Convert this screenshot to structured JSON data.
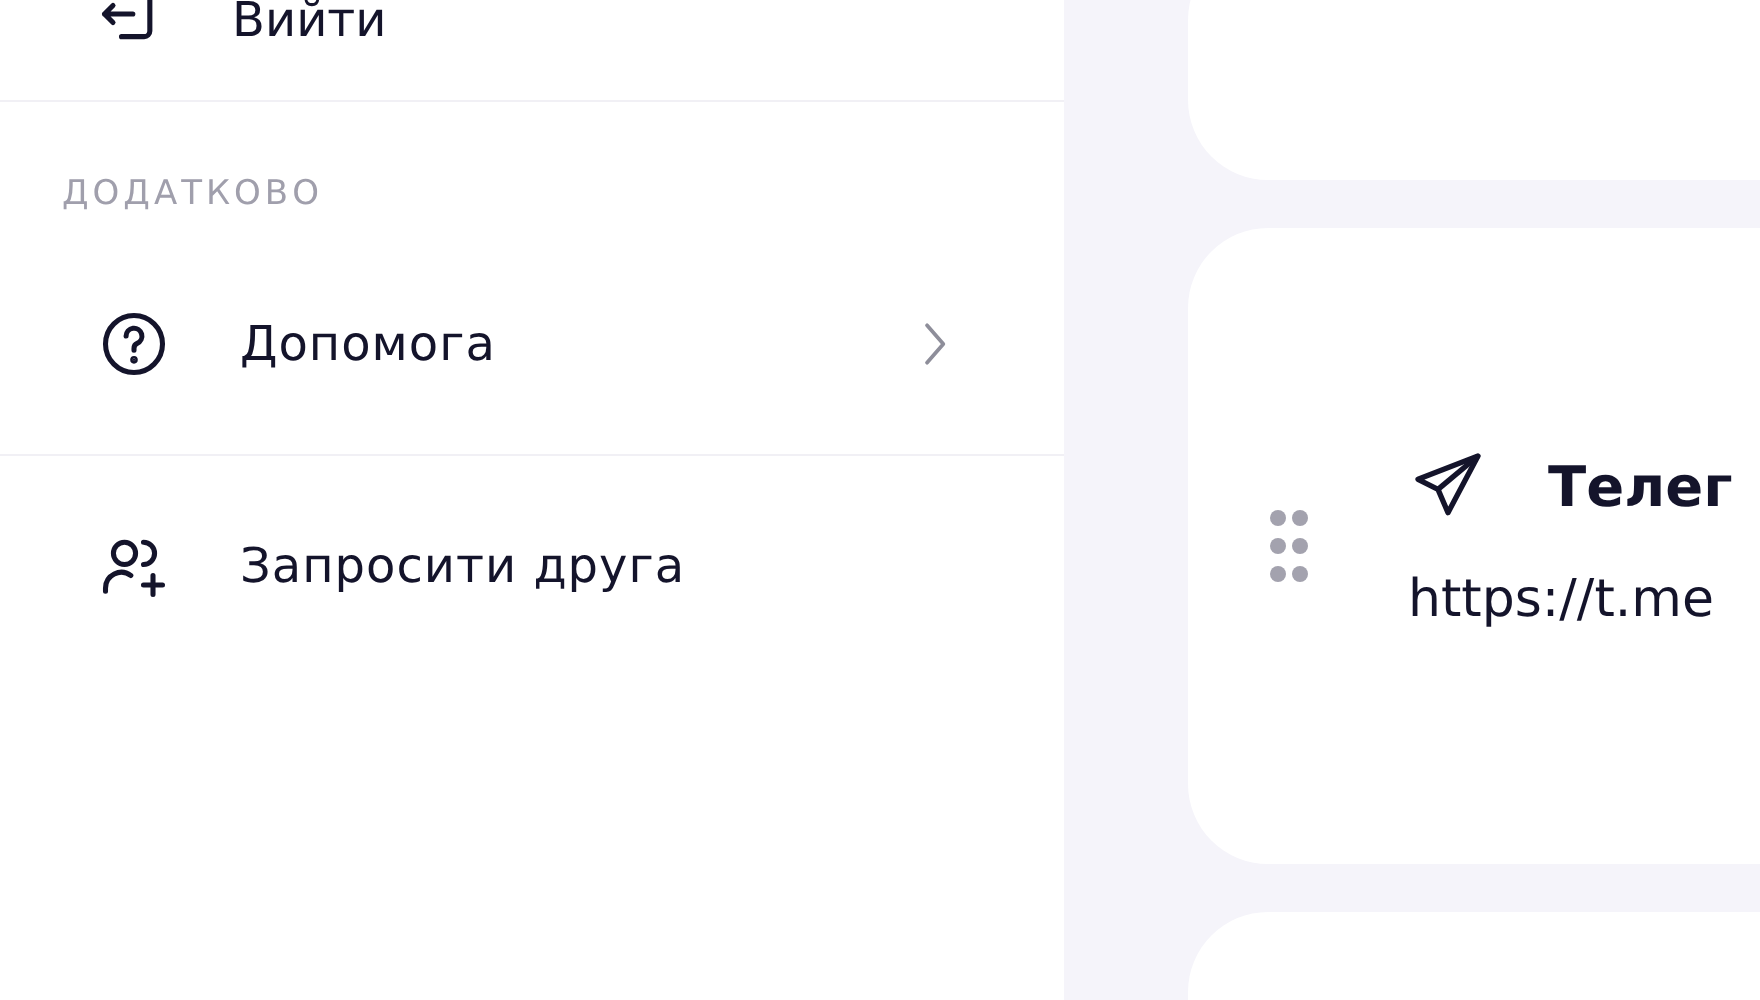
{
  "sidebar": {
    "top_item": {
      "label": "Вийти"
    },
    "section_title": "ДОДАТКОВО",
    "items": [
      {
        "kind": "help",
        "label": "Допомога",
        "has_chevron": true
      },
      {
        "kind": "invite",
        "label": "Запросити друга",
        "has_chevron": false
      }
    ]
  },
  "cards": [
    {
      "kind": "empty"
    },
    {
      "kind": "link",
      "title": "Телег",
      "url": "https://t.me"
    },
    {
      "kind": "empty"
    }
  ]
}
